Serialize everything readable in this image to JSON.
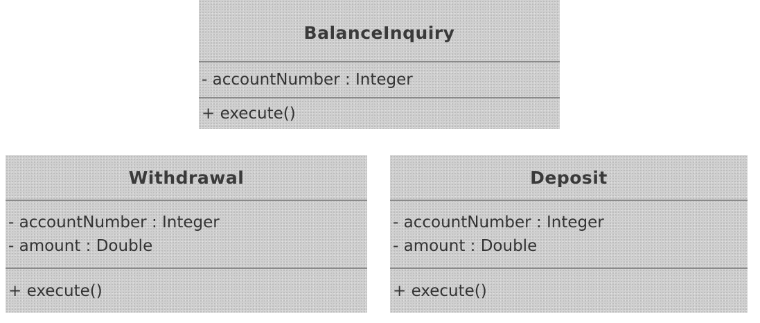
{
  "classes": [
    {
      "name": "BalanceInquiry",
      "attributes": [
        "- accountNumber : Integer"
      ],
      "operations": [
        "+ execute()"
      ]
    },
    {
      "name": "Withdrawal",
      "attributes": [
        "- accountNumber : Integer",
        "- amount : Double"
      ],
      "operations": [
        "+ execute()"
      ]
    },
    {
      "name": "Deposit",
      "attributes": [
        "- accountNumber : Integer",
        "- amount : Double"
      ],
      "operations": [
        "+ execute()"
      ]
    }
  ]
}
